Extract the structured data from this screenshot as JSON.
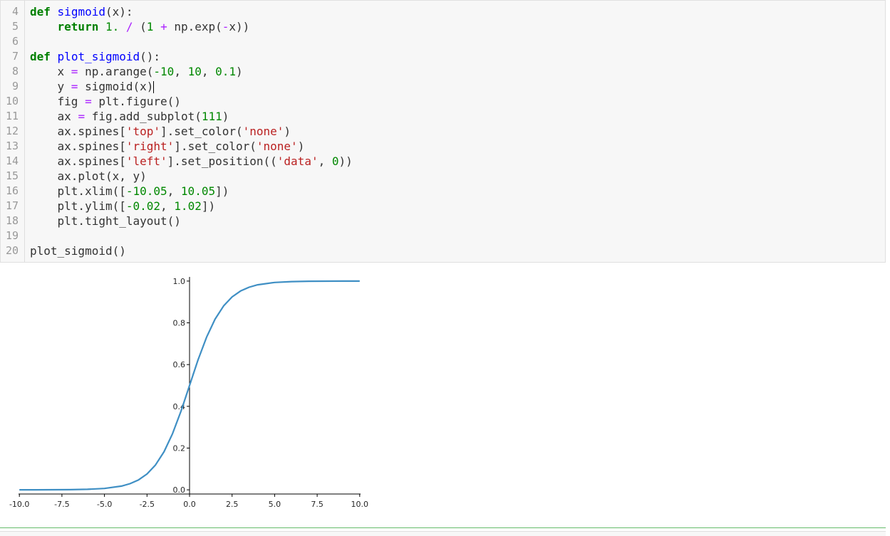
{
  "code_cell": {
    "line_numbers": [
      "4",
      "5",
      "6",
      "7",
      "8",
      "9",
      "10",
      "11",
      "12",
      "13",
      "14",
      "15",
      "16",
      "17",
      "18",
      "19",
      "20"
    ],
    "lines": [
      [
        {
          "t": "def",
          "c": "kw"
        },
        {
          "t": " "
        },
        {
          "t": "sigmoid",
          "c": "fn"
        },
        {
          "t": "(x):"
        }
      ],
      [
        {
          "t": "    "
        },
        {
          "t": "return",
          "c": "kw"
        },
        {
          "t": " "
        },
        {
          "t": "1.",
          "c": "num"
        },
        {
          "t": " "
        },
        {
          "t": "/",
          "c": "op"
        },
        {
          "t": " ("
        },
        {
          "t": "1",
          "c": "num"
        },
        {
          "t": " "
        },
        {
          "t": "+",
          "c": "op"
        },
        {
          "t": " np.exp("
        },
        {
          "t": "-",
          "c": "op"
        },
        {
          "t": "x))"
        }
      ],
      [],
      [
        {
          "t": "def",
          "c": "kw"
        },
        {
          "t": " "
        },
        {
          "t": "plot_sigmoid",
          "c": "fn"
        },
        {
          "t": "():"
        }
      ],
      [
        {
          "t": "    x "
        },
        {
          "t": "=",
          "c": "op"
        },
        {
          "t": " np.arange("
        },
        {
          "t": "-10",
          "c": "num"
        },
        {
          "t": ", "
        },
        {
          "t": "10",
          "c": "num"
        },
        {
          "t": ", "
        },
        {
          "t": "0.1",
          "c": "num"
        },
        {
          "t": ")"
        }
      ],
      [
        {
          "t": "    y "
        },
        {
          "t": "=",
          "c": "op"
        },
        {
          "t": " sigmoid(x)"
        },
        {
          "t": "",
          "c": "cursor"
        }
      ],
      [
        {
          "t": "    fig "
        },
        {
          "t": "=",
          "c": "op"
        },
        {
          "t": " plt.figure()"
        }
      ],
      [
        {
          "t": "    ax "
        },
        {
          "t": "=",
          "c": "op"
        },
        {
          "t": " fig.add_subplot("
        },
        {
          "t": "111",
          "c": "num"
        },
        {
          "t": ")"
        }
      ],
      [
        {
          "t": "    ax.spines["
        },
        {
          "t": "'top'",
          "c": "str"
        },
        {
          "t": "].set_color("
        },
        {
          "t": "'none'",
          "c": "str"
        },
        {
          "t": ")"
        }
      ],
      [
        {
          "t": "    ax.spines["
        },
        {
          "t": "'right'",
          "c": "str"
        },
        {
          "t": "].set_color("
        },
        {
          "t": "'none'",
          "c": "str"
        },
        {
          "t": ")"
        }
      ],
      [
        {
          "t": "    ax.spines["
        },
        {
          "t": "'left'",
          "c": "str"
        },
        {
          "t": "].set_position(("
        },
        {
          "t": "'data'",
          "c": "str"
        },
        {
          "t": ", "
        },
        {
          "t": "0",
          "c": "num"
        },
        {
          "t": "))"
        }
      ],
      [
        {
          "t": "    ax.plot(x, y)"
        }
      ],
      [
        {
          "t": "    plt.xlim(["
        },
        {
          "t": "-10.05",
          "c": "num"
        },
        {
          "t": ", "
        },
        {
          "t": "10.05",
          "c": "num"
        },
        {
          "t": "])"
        }
      ],
      [
        {
          "t": "    plt.ylim(["
        },
        {
          "t": "-0.02",
          "c": "num"
        },
        {
          "t": ", "
        },
        {
          "t": "1.02",
          "c": "num"
        },
        {
          "t": "])"
        }
      ],
      [
        {
          "t": "    plt.tight_layout()"
        }
      ],
      [],
      [
        {
          "t": "plot_sigmoid()"
        }
      ]
    ]
  },
  "chart_data": {
    "type": "line",
    "title": "",
    "xlabel": "",
    "ylabel": "",
    "xlim": [
      -10.05,
      10.05
    ],
    "ylim": [
      -0.02,
      1.02
    ],
    "xticks": [
      -10.0,
      -7.5,
      -5.0,
      -2.5,
      0.0,
      2.5,
      5.0,
      7.5,
      10.0
    ],
    "xtick_labels": [
      "-10.0",
      "-7.5",
      "-5.0",
      "-2.5",
      "0.0",
      "2.5",
      "5.0",
      "7.5",
      "10.0"
    ],
    "yticks": [
      0.0,
      0.2,
      0.4,
      0.6,
      0.8,
      1.0
    ],
    "ytick_labels": [
      "0.0",
      "0.2",
      "0.4",
      "0.6",
      "0.8",
      "1.0"
    ],
    "grid": false,
    "y_axis_position": "x = 0",
    "series": [
      {
        "color": "#3f8fc4",
        "x": [
          -10,
          -9,
          -8,
          -7,
          -6,
          -5,
          -4,
          -3.5,
          -3,
          -2.5,
          -2,
          -1.5,
          -1,
          -0.5,
          0,
          0.5,
          1,
          1.5,
          2,
          2.5,
          3,
          3.5,
          4,
          5,
          6,
          7,
          8,
          9,
          10
        ],
        "y": [
          5e-05,
          0.00012,
          0.00034,
          0.00091,
          0.00247,
          0.0067,
          0.018,
          0.0293,
          0.0474,
          0.0759,
          0.1192,
          0.1824,
          0.2689,
          0.3775,
          0.5,
          0.6225,
          0.7311,
          0.8176,
          0.8808,
          0.9241,
          0.9526,
          0.9707,
          0.982,
          0.9933,
          0.9975,
          0.9991,
          0.9997,
          0.9999,
          1.0
        ]
      }
    ]
  }
}
